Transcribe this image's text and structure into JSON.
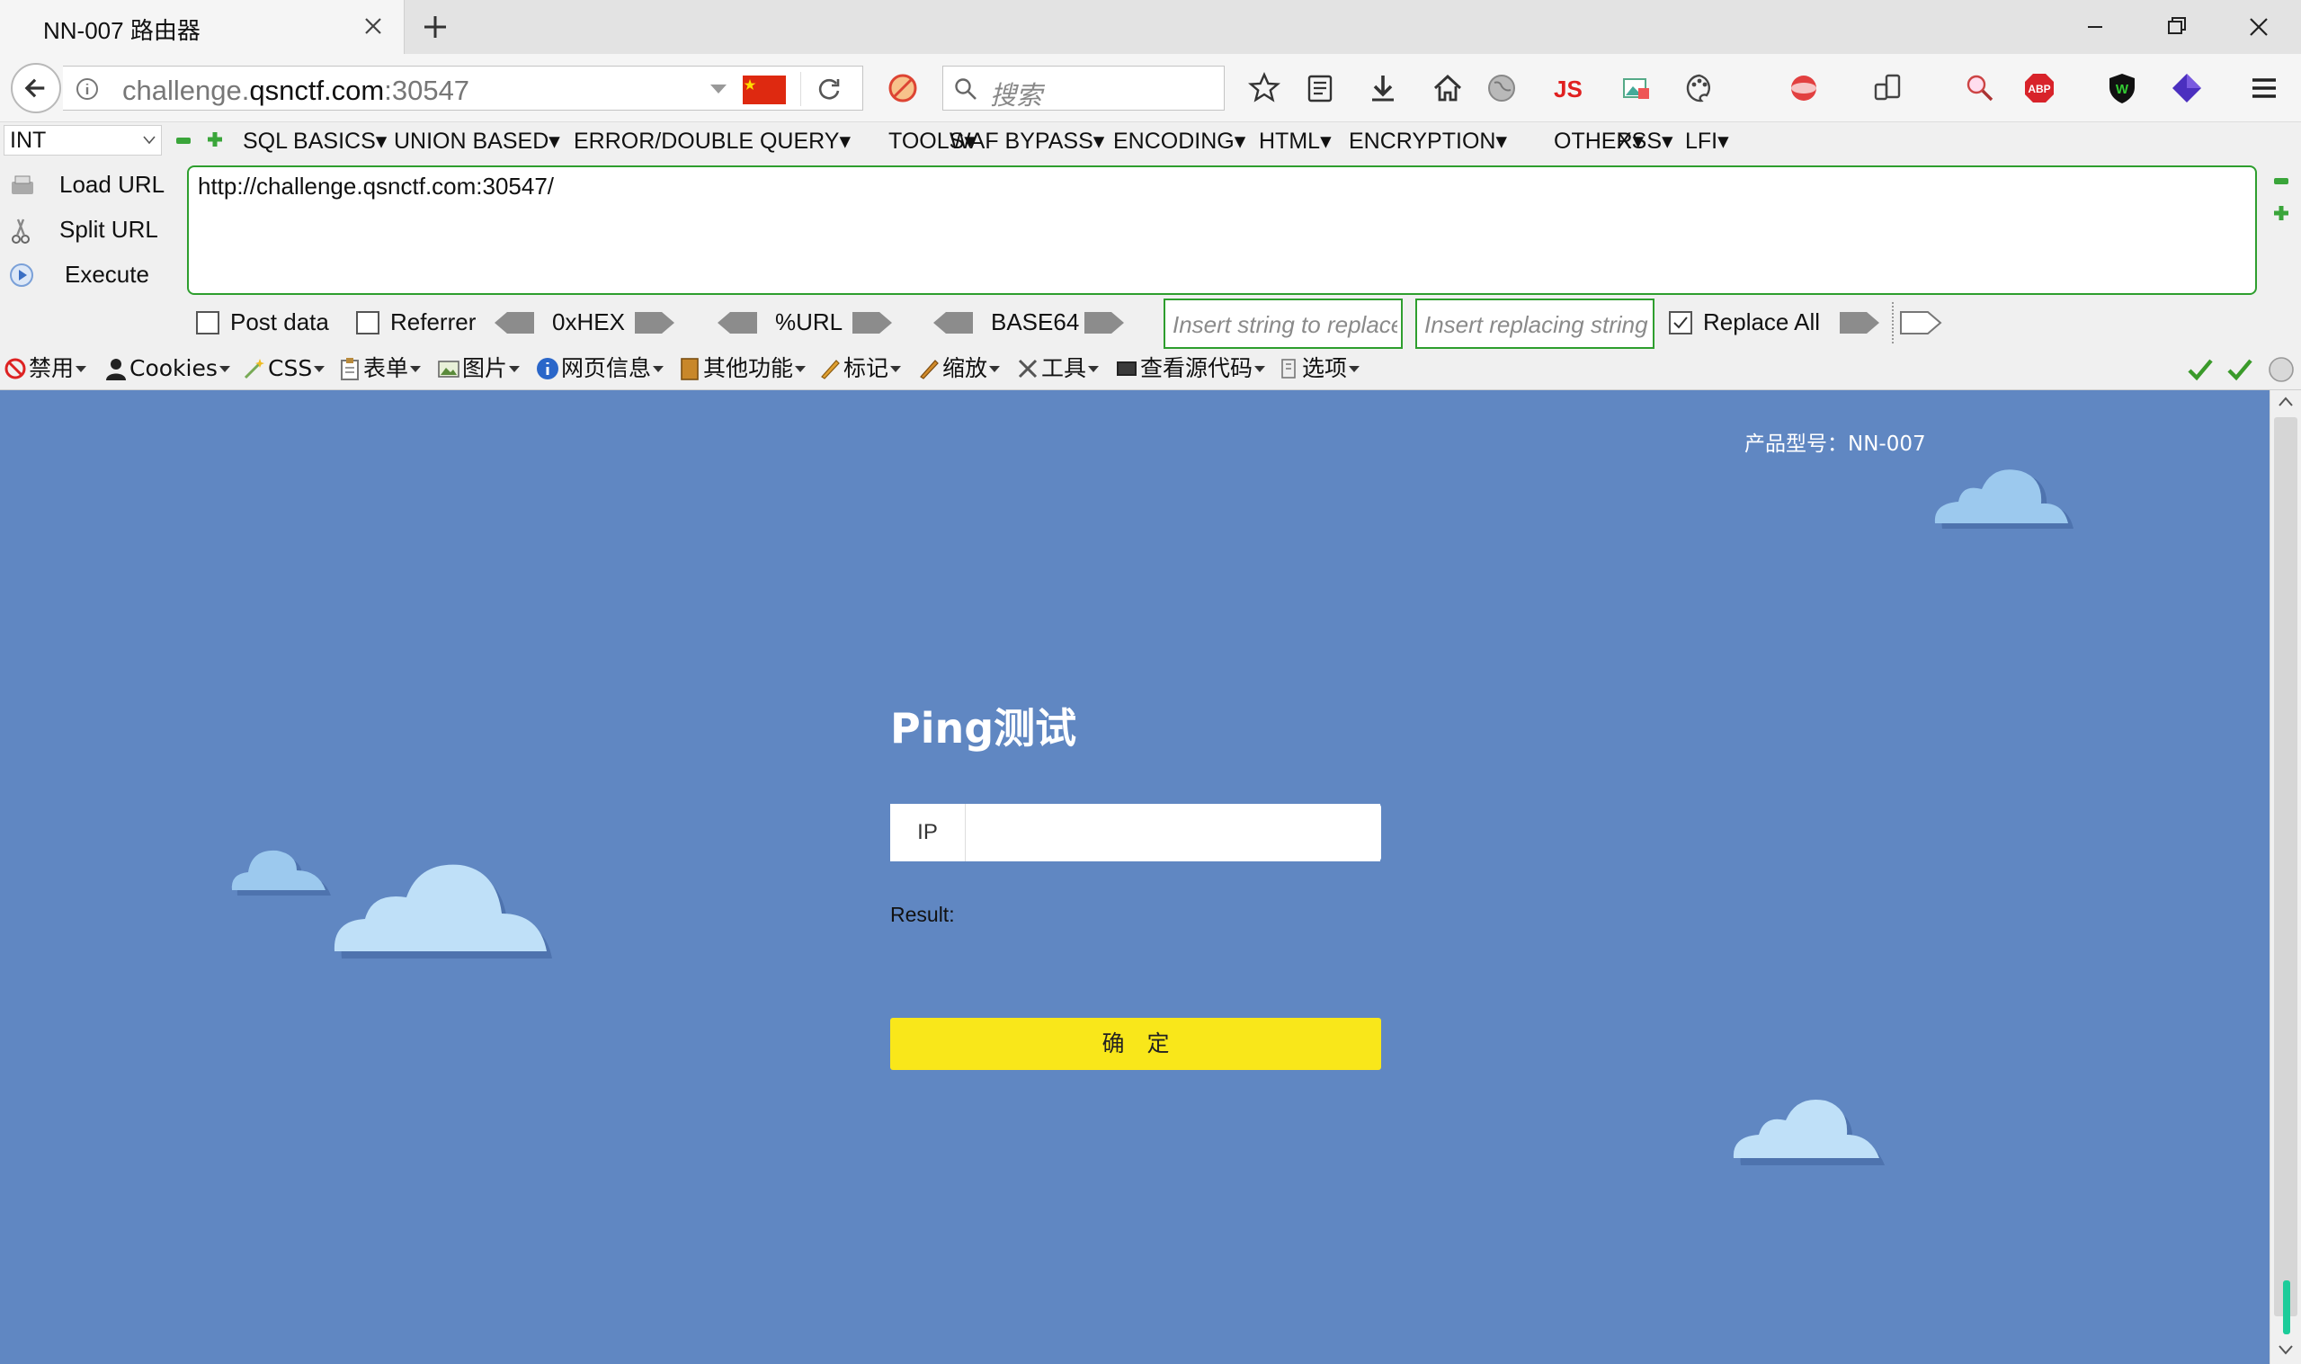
{
  "browser": {
    "tab_title": "NN-007 路由器",
    "url_host": "challenge.qsnctf.com",
    "url_port": ":30547",
    "search_placeholder": "搜索",
    "js_label": "JS"
  },
  "hackbar": {
    "select_value": "INT",
    "menus": [
      "SQL BASICS",
      "UNION BASED",
      "ERROR/DOUBLE QUERY",
      "TOOLS",
      "WAF BYPASS",
      "ENCODING",
      "HTML",
      "ENCRYPTION",
      "OTHER",
      "XSS",
      "LFI"
    ],
    "load_url": "Load URL",
    "split_url": "Split URL",
    "execute": "Execute",
    "url_value": "http://challenge.qsnctf.com:30547/",
    "post_data": "Post data",
    "referrer": "Referrer",
    "hex": "0xHEX",
    "url_enc": "%URL",
    "base64": "BASE64",
    "replace_placeholder": "Insert string to replace",
    "replacing_placeholder": "Insert replacing string",
    "replace_all": "Replace All"
  },
  "devbar": {
    "items": [
      "禁用",
      "Cookies",
      "CSS",
      "表单",
      "图片",
      "网页信息",
      "其他功能",
      "标记",
      "缩放",
      "工具",
      "查看源代码",
      "选项"
    ]
  },
  "page": {
    "product_model": "产品型号：NN-007",
    "title": "Ping测试",
    "ip_label": "IP",
    "ip_value": "",
    "result_label": "Result:",
    "submit_label": "确　定",
    "colors": {
      "background": "#6087c2",
      "button": "#f9e71a",
      "cloud": "#9cc9ee"
    }
  }
}
